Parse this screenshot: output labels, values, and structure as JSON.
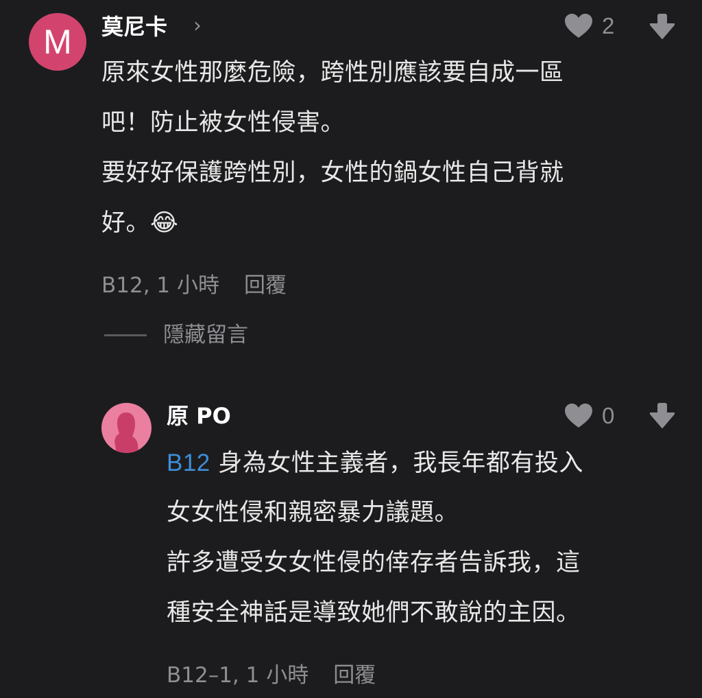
{
  "comments": [
    {
      "avatar_letter": "M",
      "author": "莫尼卡",
      "author_chevron": "›",
      "likes": "2",
      "icons": [
        "heart-icon",
        "download-icon"
      ],
      "body_lines": [
        "原來女性那麼危險，跨性別應該要自成一區",
        "吧！防止被女性侵害。",
        "要好好保護跨性別，女性的鍋女性自己背就",
        "好。😂"
      ],
      "floor_time": "B12, 1 小時",
      "reply_label": "回覆",
      "hide_label": "隱藏留言"
    },
    {
      "author": "原 PO",
      "likes": "0",
      "icons": [
        "heart-icon",
        "download-icon"
      ],
      "mention": "B12",
      "body_lines": [
        "身為女性主義者，我長年都有投入",
        "女女性侵和親密暴力議題。",
        "許多遭受女女性侵的倖存者告訴我，這",
        "種安全神話是導致她們不敢說的主因。"
      ],
      "floor_time": "B12–1, 1 小時",
      "reply_label": "回覆"
    }
  ],
  "colors": {
    "background": "#1c1c1e",
    "avatar_m": "#d2446e",
    "avatar_po": "#eb7f9f",
    "mention": "#3d8ed9",
    "muted": "#8e8e93"
  }
}
